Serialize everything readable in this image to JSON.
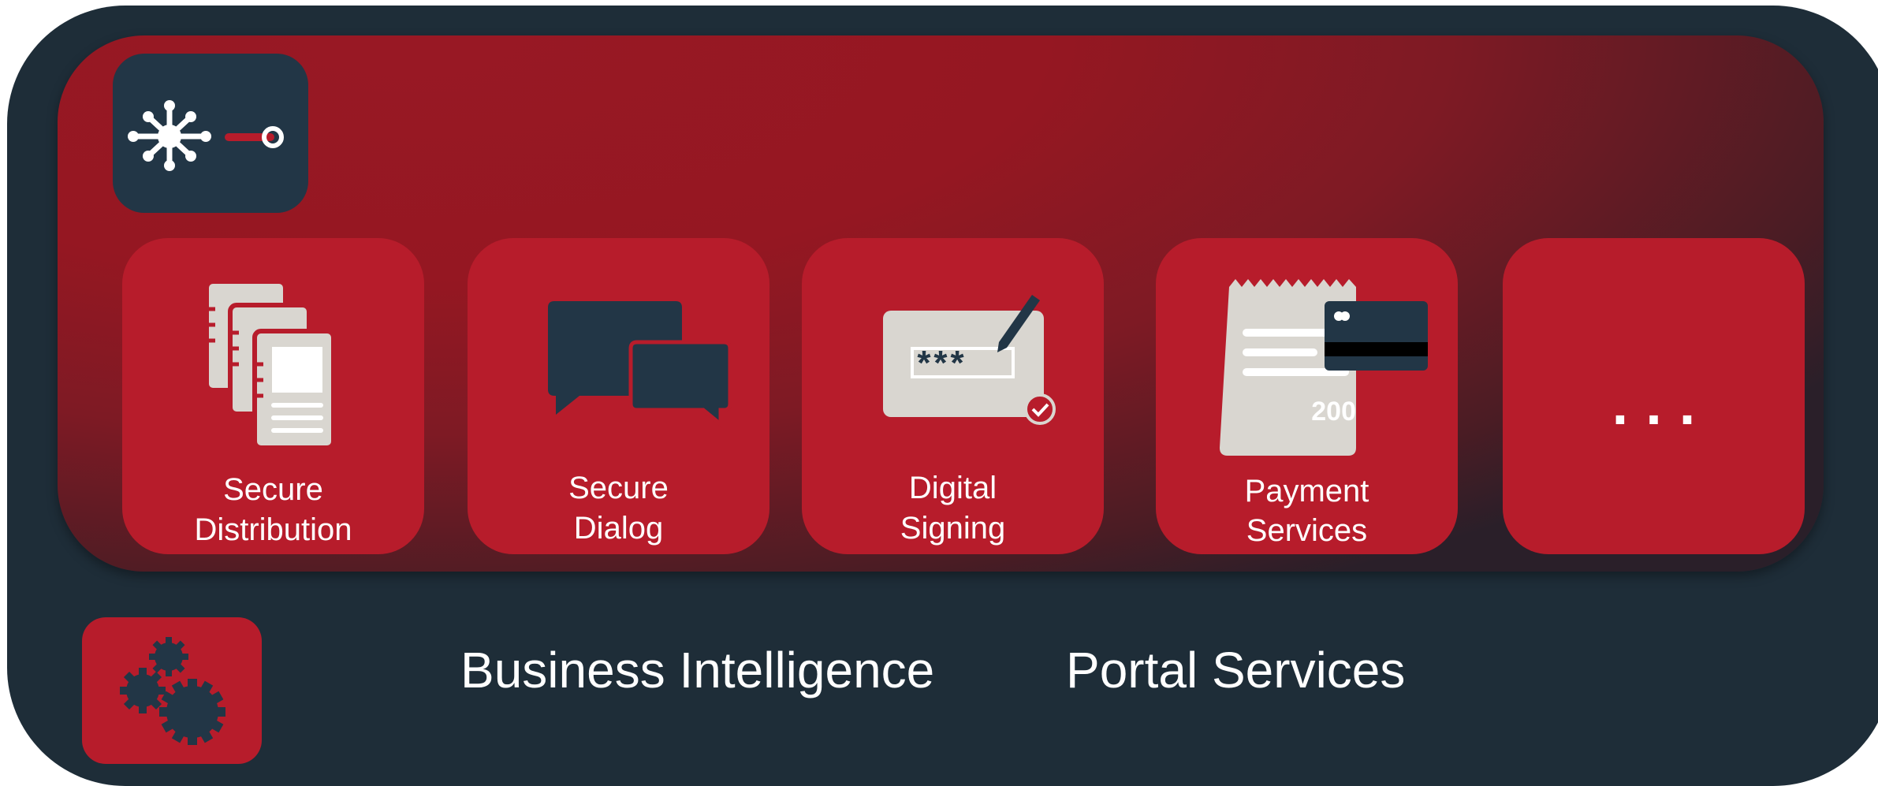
{
  "colors": {
    "outer": "#1e2d38",
    "band": "#951722",
    "card": "#b71c2b",
    "icon_dark": "#223646",
    "icon_light": "#d9d6d0",
    "text": "#ffffff"
  },
  "hub": {
    "icon": "network-hub-icon"
  },
  "services": [
    {
      "label_line1": "Secure",
      "label_line2": "Distribution",
      "icon": "documents-icon"
    },
    {
      "label_line1": "Secure",
      "label_line2": "Dialog",
      "icon": "chat-bubbles-icon"
    },
    {
      "label_line1": "Digital",
      "label_line2": "Signing",
      "icon": "password-signing-icon",
      "password_mask": "***"
    },
    {
      "label_line1": "Payment",
      "label_line2": "Services",
      "icon": "receipt-card-icon",
      "amount": "200"
    },
    {
      "more": "..."
    }
  ],
  "bottom": {
    "gears_icon": "gears-icon",
    "business_intelligence": "Business Intelligence",
    "portal_services": "Portal Services"
  }
}
